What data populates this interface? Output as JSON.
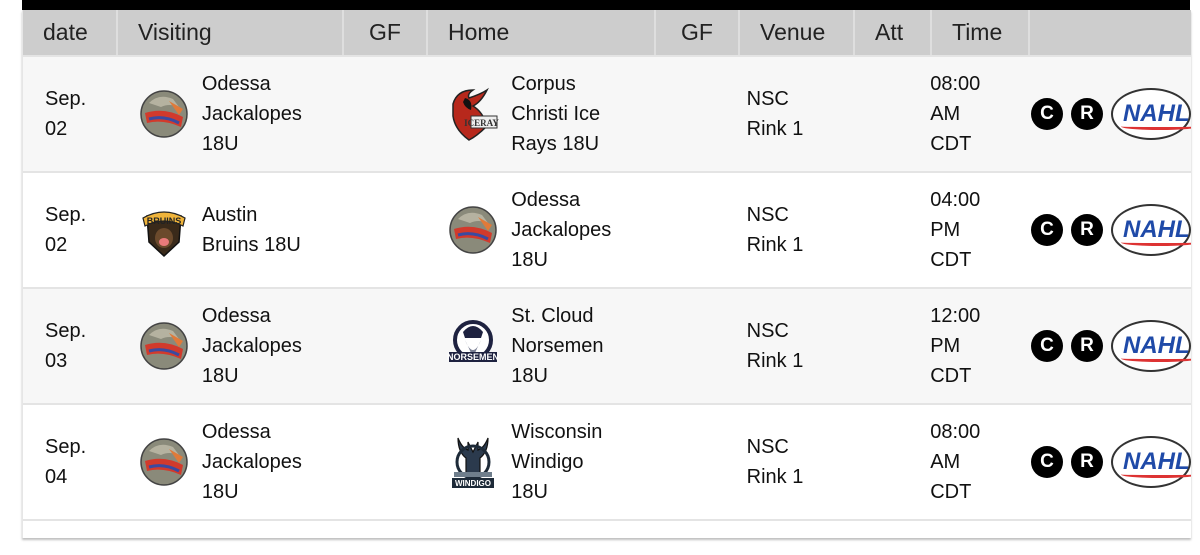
{
  "table": {
    "headers": {
      "date": "date",
      "visiting": "Visiting",
      "gf_visiting": "GF",
      "home": "Home",
      "gf_home": "GF",
      "venue": "Venue",
      "att": "Att",
      "time": "Time"
    },
    "rows": [
      {
        "date_line1": "Sep.",
        "date_line2": "02",
        "visiting": {
          "name_lines": [
            "Odessa",
            "Jackalopes",
            "18U"
          ],
          "logo": "odessa-jackalopes-logo"
        },
        "gf_visiting": "",
        "home": {
          "name_lines": [
            "Corpus",
            "Christi Ice",
            "Rays 18U"
          ],
          "logo": "corpus-christi-ice-rays-logo"
        },
        "gf_home": "",
        "venue_lines": [
          "NSC",
          "Rink 1"
        ],
        "att": "",
        "time_lines": [
          "08:00",
          "AM",
          "CDT"
        ],
        "icons": {
          "c": "C",
          "r": "R",
          "league": "NAHL"
        }
      },
      {
        "date_line1": "Sep.",
        "date_line2": "02",
        "visiting": {
          "name_lines": [
            "Austin",
            "Bruins 18U",
            ""
          ],
          "logo": "austin-bruins-logo"
        },
        "gf_visiting": "",
        "home": {
          "name_lines": [
            "Odessa",
            "Jackalopes",
            "18U"
          ],
          "logo": "odessa-jackalopes-logo"
        },
        "gf_home": "",
        "venue_lines": [
          "NSC",
          "Rink 1"
        ],
        "att": "",
        "time_lines": [
          "04:00",
          "PM",
          "CDT"
        ],
        "icons": {
          "c": "C",
          "r": "R",
          "league": "NAHL"
        }
      },
      {
        "date_line1": "Sep.",
        "date_line2": "03",
        "visiting": {
          "name_lines": [
            "Odessa",
            "Jackalopes",
            "18U"
          ],
          "logo": "odessa-jackalopes-logo"
        },
        "gf_visiting": "",
        "home": {
          "name_lines": [
            "St. Cloud",
            "Norsemen",
            "18U"
          ],
          "logo": "st-cloud-norsemen-logo"
        },
        "gf_home": "",
        "venue_lines": [
          "NSC",
          "Rink 1"
        ],
        "att": "",
        "time_lines": [
          "12:00",
          "PM",
          "CDT"
        ],
        "icons": {
          "c": "C",
          "r": "R",
          "league": "NAHL"
        }
      },
      {
        "date_line1": "Sep.",
        "date_line2": "04",
        "visiting": {
          "name_lines": [
            "Odessa",
            "Jackalopes",
            "18U"
          ],
          "logo": "odessa-jackalopes-logo"
        },
        "gf_visiting": "",
        "home": {
          "name_lines": [
            "Wisconsin",
            "Windigo",
            "18U"
          ],
          "logo": "wisconsin-windigo-logo"
        },
        "gf_home": "",
        "venue_lines": [
          "NSC",
          "Rink 1"
        ],
        "att": "",
        "time_lines": [
          "08:00",
          "AM",
          "CDT"
        ],
        "icons": {
          "c": "C",
          "r": "R",
          "league": "NAHL"
        }
      }
    ]
  },
  "colors": {
    "header_bg": "#cdcdcd",
    "row_alt_bg": "#f7f7f7",
    "league_blue": "#1f4aa8",
    "league_red": "#dd3333"
  }
}
